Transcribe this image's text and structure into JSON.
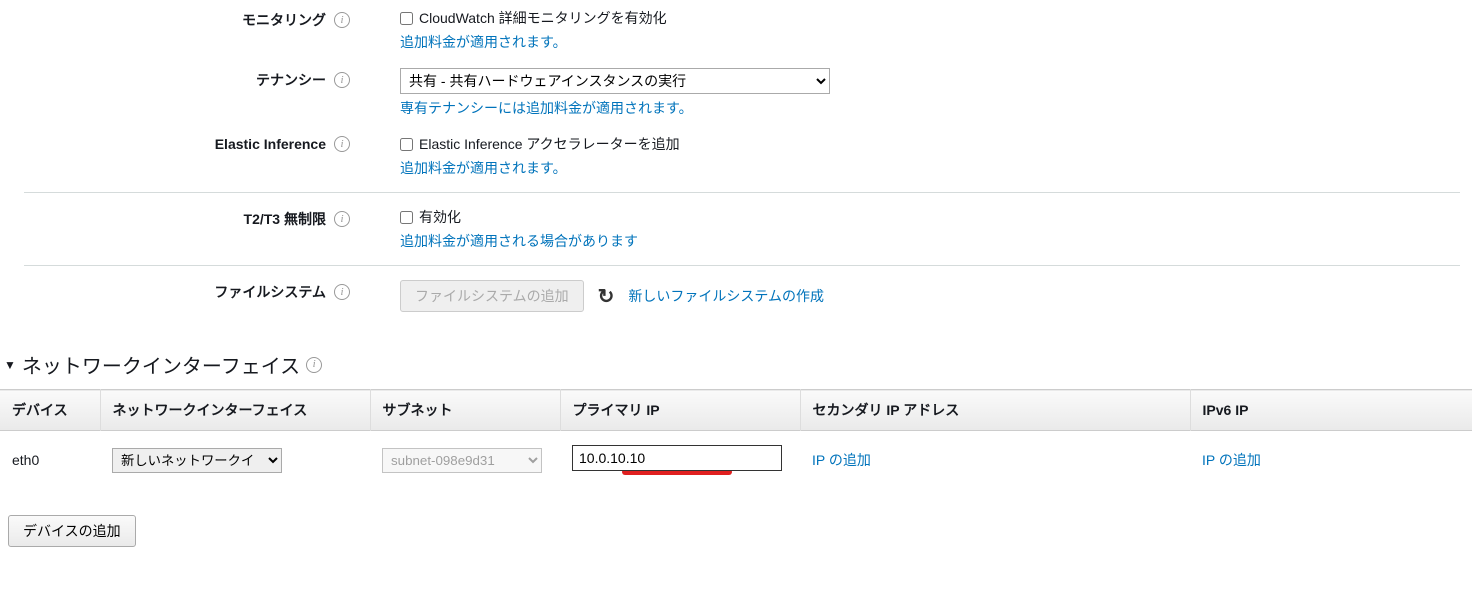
{
  "monitoring": {
    "label": "モニタリング",
    "checkbox_label": "CloudWatch 詳細モニタリングを有効化",
    "note_link": "追加料金が適用されます。"
  },
  "tenancy": {
    "label": "テナンシー",
    "selected": "共有 - 共有ハードウェアインスタンスの実行",
    "note_link": "専有テナンシーには追加料金が適用されます。"
  },
  "elastic_inference": {
    "label": "Elastic Inference",
    "checkbox_label": "Elastic Inference アクセラレーターを追加",
    "note_link": "追加料金が適用されます。"
  },
  "t2t3": {
    "label": "T2/T3 無制限",
    "checkbox_label": "有効化",
    "note_link": "追加料金が適用される場合があります"
  },
  "filesystem": {
    "label": "ファイルシステム",
    "add_button": "ファイルシステムの追加",
    "create_link": "新しいファイルシステムの作成"
  },
  "network_interface": {
    "section_title": "ネットワークインターフェイス",
    "headers": {
      "device": "デバイス",
      "ni": "ネットワークインターフェイス",
      "subnet": "サブネット",
      "primary_ip": "プライマリ IP",
      "secondary_ip": "セカンダリ IP アドレス",
      "ipv6": "IPv6 IP"
    },
    "row": {
      "device": "eth0",
      "ni_selected": "新しいネットワークイ",
      "subnet_selected": "subnet-098e9d31",
      "primary_ip": "10.0.10.10",
      "add_ip_link": "IP の追加"
    },
    "add_device": "デバイスの追加"
  }
}
